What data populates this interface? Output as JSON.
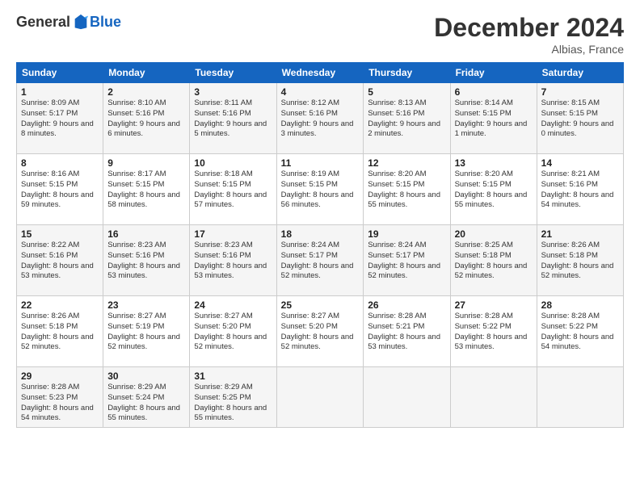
{
  "header": {
    "logo_general": "General",
    "logo_blue": "Blue",
    "month_year": "December 2024",
    "location": "Albias, France"
  },
  "weekdays": [
    "Sunday",
    "Monday",
    "Tuesday",
    "Wednesday",
    "Thursday",
    "Friday",
    "Saturday"
  ],
  "weeks": [
    [
      {
        "day": "1",
        "sunrise": "8:09 AM",
        "sunset": "5:17 PM",
        "daylight": "9 hours and 8 minutes."
      },
      {
        "day": "2",
        "sunrise": "8:10 AM",
        "sunset": "5:16 PM",
        "daylight": "9 hours and 6 minutes."
      },
      {
        "day": "3",
        "sunrise": "8:11 AM",
        "sunset": "5:16 PM",
        "daylight": "9 hours and 5 minutes."
      },
      {
        "day": "4",
        "sunrise": "8:12 AM",
        "sunset": "5:16 PM",
        "daylight": "9 hours and 3 minutes."
      },
      {
        "day": "5",
        "sunrise": "8:13 AM",
        "sunset": "5:16 PM",
        "daylight": "9 hours and 2 minutes."
      },
      {
        "day": "6",
        "sunrise": "8:14 AM",
        "sunset": "5:15 PM",
        "daylight": "9 hours and 1 minute."
      },
      {
        "day": "7",
        "sunrise": "8:15 AM",
        "sunset": "5:15 PM",
        "daylight": "9 hours and 0 minutes."
      }
    ],
    [
      {
        "day": "8",
        "sunrise": "8:16 AM",
        "sunset": "5:15 PM",
        "daylight": "8 hours and 59 minutes."
      },
      {
        "day": "9",
        "sunrise": "8:17 AM",
        "sunset": "5:15 PM",
        "daylight": "8 hours and 58 minutes."
      },
      {
        "day": "10",
        "sunrise": "8:18 AM",
        "sunset": "5:15 PM",
        "daylight": "8 hours and 57 minutes."
      },
      {
        "day": "11",
        "sunrise": "8:19 AM",
        "sunset": "5:15 PM",
        "daylight": "8 hours and 56 minutes."
      },
      {
        "day": "12",
        "sunrise": "8:20 AM",
        "sunset": "5:15 PM",
        "daylight": "8 hours and 55 minutes."
      },
      {
        "day": "13",
        "sunrise": "8:20 AM",
        "sunset": "5:15 PM",
        "daylight": "8 hours and 55 minutes."
      },
      {
        "day": "14",
        "sunrise": "8:21 AM",
        "sunset": "5:16 PM",
        "daylight": "8 hours and 54 minutes."
      }
    ],
    [
      {
        "day": "15",
        "sunrise": "8:22 AM",
        "sunset": "5:16 PM",
        "daylight": "8 hours and 53 minutes."
      },
      {
        "day": "16",
        "sunrise": "8:23 AM",
        "sunset": "5:16 PM",
        "daylight": "8 hours and 53 minutes."
      },
      {
        "day": "17",
        "sunrise": "8:23 AM",
        "sunset": "5:16 PM",
        "daylight": "8 hours and 53 minutes."
      },
      {
        "day": "18",
        "sunrise": "8:24 AM",
        "sunset": "5:17 PM",
        "daylight": "8 hours and 52 minutes."
      },
      {
        "day": "19",
        "sunrise": "8:24 AM",
        "sunset": "5:17 PM",
        "daylight": "8 hours and 52 minutes."
      },
      {
        "day": "20",
        "sunrise": "8:25 AM",
        "sunset": "5:18 PM",
        "daylight": "8 hours and 52 minutes."
      },
      {
        "day": "21",
        "sunrise": "8:26 AM",
        "sunset": "5:18 PM",
        "daylight": "8 hours and 52 minutes."
      }
    ],
    [
      {
        "day": "22",
        "sunrise": "8:26 AM",
        "sunset": "5:18 PM",
        "daylight": "8 hours and 52 minutes."
      },
      {
        "day": "23",
        "sunrise": "8:27 AM",
        "sunset": "5:19 PM",
        "daylight": "8 hours and 52 minutes."
      },
      {
        "day": "24",
        "sunrise": "8:27 AM",
        "sunset": "5:20 PM",
        "daylight": "8 hours and 52 minutes."
      },
      {
        "day": "25",
        "sunrise": "8:27 AM",
        "sunset": "5:20 PM",
        "daylight": "8 hours and 52 minutes."
      },
      {
        "day": "26",
        "sunrise": "8:28 AM",
        "sunset": "5:21 PM",
        "daylight": "8 hours and 53 minutes."
      },
      {
        "day": "27",
        "sunrise": "8:28 AM",
        "sunset": "5:22 PM",
        "daylight": "8 hours and 53 minutes."
      },
      {
        "day": "28",
        "sunrise": "8:28 AM",
        "sunset": "5:22 PM",
        "daylight": "8 hours and 54 minutes."
      }
    ],
    [
      {
        "day": "29",
        "sunrise": "8:28 AM",
        "sunset": "5:23 PM",
        "daylight": "8 hours and 54 minutes."
      },
      {
        "day": "30",
        "sunrise": "8:29 AM",
        "sunset": "5:24 PM",
        "daylight": "8 hours and 55 minutes."
      },
      {
        "day": "31",
        "sunrise": "8:29 AM",
        "sunset": "5:25 PM",
        "daylight": "8 hours and 55 minutes."
      },
      null,
      null,
      null,
      null
    ]
  ]
}
